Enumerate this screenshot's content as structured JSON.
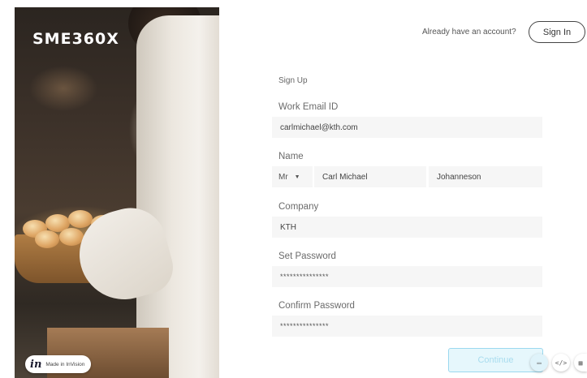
{
  "brand": {
    "name": "SME360X"
  },
  "badge": {
    "logo": "in",
    "label": "Made in InVision"
  },
  "header": {
    "prompt": "Already have an account?",
    "signin_label": "Sign In"
  },
  "form": {
    "heading": "Sign Up",
    "email": {
      "label": "Work Email ID",
      "value": "carlmichael@kth.com"
    },
    "name": {
      "label": "Name",
      "title": "Mr",
      "first": "Carl Michael",
      "last": "Johanneson"
    },
    "company": {
      "label": "Company",
      "value": "KTH"
    },
    "password": {
      "label": "Set Password",
      "value": "***************"
    },
    "confirm": {
      "label": "Confirm Password",
      "value": "***************"
    },
    "continue_label": "Continue"
  },
  "toolbar": {
    "icons": [
      "comment-icon",
      "code-icon",
      "grid-icon"
    ],
    "comment_glyph": "▭",
    "code_glyph": "</>",
    "grid_glyph": "▦"
  },
  "colors": {
    "accent_border": "#9bd8ef",
    "continue_bg": "#e6f7fc",
    "field_bg": "#f6f6f6"
  }
}
